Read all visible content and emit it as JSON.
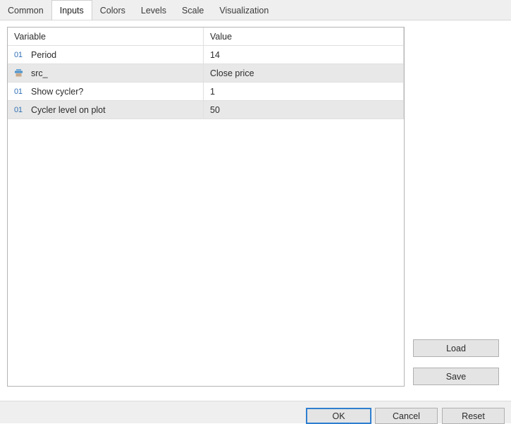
{
  "tabs": [
    {
      "label": "Common",
      "active": false
    },
    {
      "label": "Inputs",
      "active": true
    },
    {
      "label": "Colors",
      "active": false
    },
    {
      "label": "Levels",
      "active": false
    },
    {
      "label": "Scale",
      "active": false
    },
    {
      "label": "Visualization",
      "active": false
    }
  ],
  "table": {
    "columns": {
      "variable": "Variable",
      "value": "Value"
    },
    "rows": [
      {
        "icon": "integer-01-icon",
        "variable": "Period",
        "value": "14",
        "shaded": false
      },
      {
        "icon": "source-series-icon",
        "variable": "src_",
        "value": "Close price",
        "shaded": true
      },
      {
        "icon": "integer-01-icon",
        "variable": "Show cycler?",
        "value": "1",
        "shaded": false
      },
      {
        "icon": "integer-01-icon",
        "variable": "Cycler level on plot",
        "value": "50",
        "shaded": true
      }
    ],
    "integer_icon_text": "01"
  },
  "side_buttons": {
    "load": "Load",
    "save": "Save"
  },
  "footer_buttons": {
    "ok": "OK",
    "cancel": "Cancel",
    "reset": "Reset"
  },
  "colors": {
    "accent_blue": "#2f7fd0",
    "icon_blue": "#2f6fb5",
    "row_shade": "#e8e8e8",
    "chrome_gray": "#efefef",
    "button_face": "#e4e4e4"
  }
}
